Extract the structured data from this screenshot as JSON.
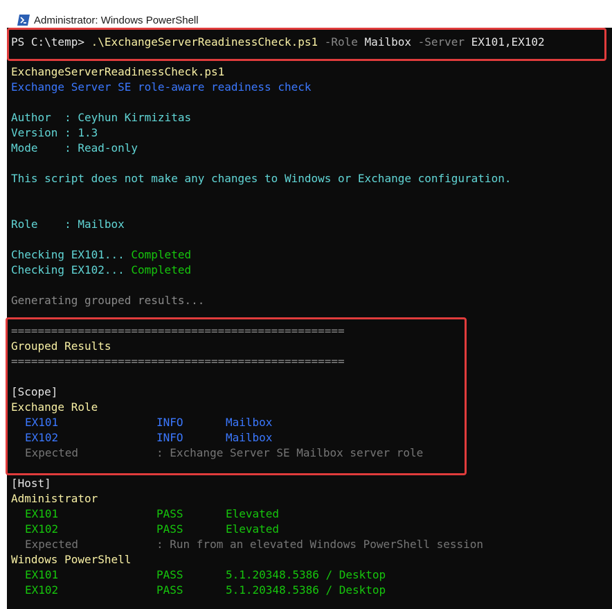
{
  "window": {
    "title": "Administrator: Windows PowerShell"
  },
  "colors": {
    "highlight": "#e03c3c",
    "console_bg": "#0c0c0c"
  },
  "console": {
    "command": {
      "prompt": "PS C:\\temp> ",
      "script": ".\\ExchangeServerReadinessCheck.ps1",
      "role_flag": " -Role",
      "role_value": " Mailbox",
      "server_flag": " -Server",
      "server_value": " EX101,EX102"
    },
    "header": {
      "script_name": "ExchangeServerReadinessCheck.ps1",
      "description": "Exchange Server SE role-aware readiness check",
      "author": "Author  : Ceyhun Kirmizitas",
      "version": "Version : 1.3",
      "mode": "Mode    : Read-only",
      "notice": "This script does not make any changes to Windows or Exchange configuration.",
      "role": "Role    : Mailbox"
    },
    "checks": [
      {
        "label": "Checking EX101... ",
        "status": "Completed"
      },
      {
        "label": "Checking EX102... ",
        "status": "Completed"
      }
    ],
    "generating": "Generating grouped results...",
    "separator": "==================================================",
    "grouped_title": "Grouped Results",
    "scope": {
      "section": "[Scope]",
      "group": "Exchange Role",
      "rows": [
        {
          "server": "EX101",
          "status": "INFO",
          "value": "Mailbox"
        },
        {
          "server": "EX102",
          "status": "INFO",
          "value": "Mailbox"
        }
      ],
      "expected_label": "Expected",
      "expected_value": ": Exchange Server SE Mailbox server role"
    },
    "host": {
      "section": "[Host]",
      "admin_group": "Administrator",
      "admin_rows": [
        {
          "server": "EX101",
          "status": "PASS",
          "value": "Elevated"
        },
        {
          "server": "EX102",
          "status": "PASS",
          "value": "Elevated"
        }
      ],
      "admin_expected_label": "Expected",
      "admin_expected_value": ": Run from an elevated Windows PowerShell session",
      "ps_group": "Windows PowerShell",
      "ps_rows": [
        {
          "server": "EX101",
          "status": "PASS",
          "value": "5.1.20348.5386 / Desktop"
        },
        {
          "server": "EX102",
          "status": "PASS",
          "value": "5.1.20348.5386 / Desktop"
        }
      ]
    }
  }
}
